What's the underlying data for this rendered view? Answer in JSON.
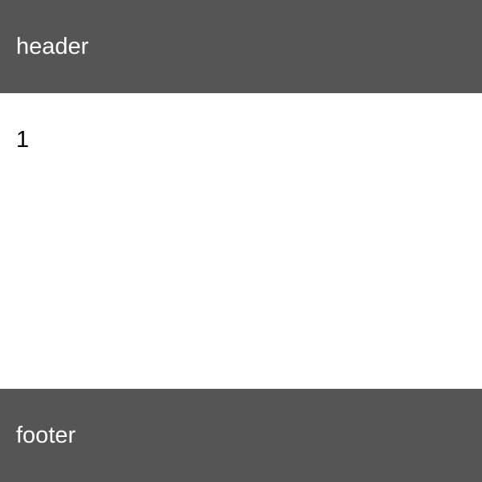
{
  "header": {
    "title": "header"
  },
  "main": {
    "items": [
      "1"
    ]
  },
  "footer": {
    "text": "footer"
  },
  "colors": {
    "bar_background": "#555555",
    "bar_text": "#ffffff",
    "content_background": "#ffffff",
    "content_text": "#000000"
  }
}
